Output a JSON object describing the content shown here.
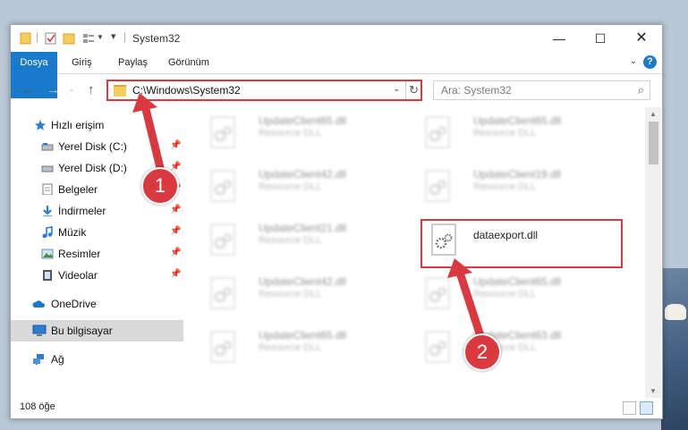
{
  "window": {
    "title": "System32"
  },
  "ribbon": {
    "tabs": [
      "Dosya",
      "Giriş",
      "Paylaş",
      "Görünüm"
    ],
    "help": "?"
  },
  "address": {
    "path": "C:\\Windows\\System32"
  },
  "search": {
    "placeholder": "Ara: System32"
  },
  "navigation": {
    "items": [
      {
        "label": "Hızlı erişim",
        "icon": "star-icon"
      },
      {
        "label": "Yerel Disk (C:)",
        "icon": "drive-icon",
        "pinned": true
      },
      {
        "label": "Yerel Disk (D:)",
        "icon": "drive-icon",
        "pinned": true
      },
      {
        "label": "Belgeler",
        "icon": "documents-icon",
        "pinned": true
      },
      {
        "label": "İndirmeler",
        "icon": "downloads-icon",
        "pinned": true
      },
      {
        "label": "Müzik",
        "icon": "music-icon",
        "pinned": true
      },
      {
        "label": "Resimler",
        "icon": "pictures-icon",
        "pinned": true
      },
      {
        "label": "Videolar",
        "icon": "videos-icon",
        "pinned": true
      },
      {
        "label": "OneDrive",
        "icon": "cloud-icon"
      },
      {
        "label": "Bu bilgisayar",
        "icon": "computer-icon",
        "selected": true
      },
      {
        "label": "Ağ",
        "icon": "network-icon"
      }
    ]
  },
  "files": [
    {
      "name": "UpdateClient65.dll",
      "type": "Resource DLL",
      "blurred": true
    },
    {
      "name": "UpdateClient65.dll",
      "type": "Resource DLL",
      "blurred": true
    },
    {
      "name": "UpdateClient42.dll",
      "type": "Resource DLL",
      "blurred": true
    },
    {
      "name": "UpdateClient19.dll",
      "type": "Resource DLL",
      "blurred": true
    },
    {
      "name": "UpdateClient21.dll",
      "type": "Resource DLL",
      "blurred": true
    },
    {
      "name": "dataexport.dll",
      "type": "",
      "blurred": false
    },
    {
      "name": "UpdateClient42.dll",
      "type": "Resource DLL",
      "blurred": true
    },
    {
      "name": "UpdateClient65.dll",
      "type": "Resource DLL",
      "blurred": true
    },
    {
      "name": "UpdateClient65.dll",
      "type": "Resource DLL",
      "blurred": true
    },
    {
      "name": "UpdateClient63.dll",
      "type": "Resource DLL",
      "blurred": true
    }
  ],
  "status": {
    "count": "108 öğe"
  },
  "callouts": [
    "1",
    "2"
  ],
  "colors": {
    "accent": "#1979ca",
    "highlight": "#d9393f"
  }
}
